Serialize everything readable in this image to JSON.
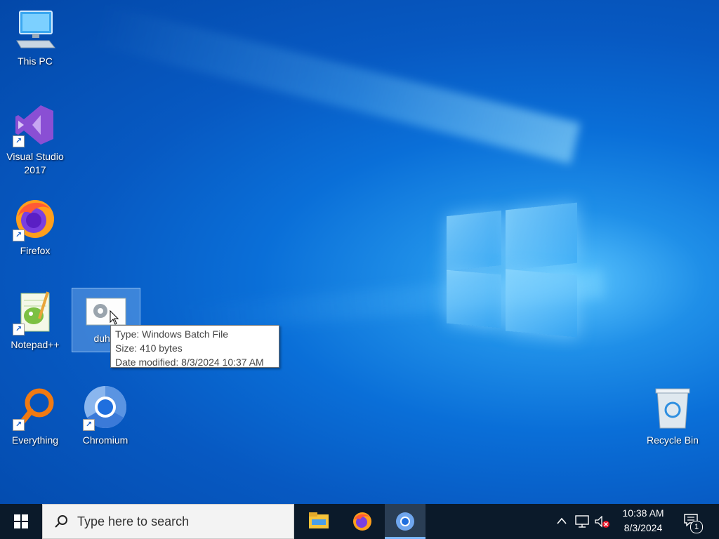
{
  "desktop": {
    "icons": {
      "this_pc": {
        "label": "This PC",
        "icon": "computer-icon"
      },
      "visual_studio": {
        "label": "Visual Studio\n2017",
        "icon": "visual-studio-icon"
      },
      "firefox": {
        "label": "Firefox",
        "icon": "firefox-icon"
      },
      "notepad": {
        "label": "Notepad++",
        "icon": "notepadpp-icon"
      },
      "duh": {
        "label": "duh.b",
        "icon": "batch-file-icon"
      },
      "everything": {
        "label": "Everything",
        "icon": "magnifier-icon"
      },
      "chromium": {
        "label": "Chromium",
        "icon": "chromium-icon"
      },
      "recycle_bin": {
        "label": "Recycle Bin",
        "icon": "recycle-bin-icon"
      }
    },
    "tooltip": {
      "type": "Type: Windows Batch File",
      "size": "Size: 410 bytes",
      "modified": "Date modified: 8/3/2024 10:37 AM"
    }
  },
  "taskbar": {
    "search_placeholder": "Type here to search",
    "apps": [
      "file-explorer-icon",
      "firefox-icon",
      "chromium-icon"
    ],
    "clock_time": "10:38 AM",
    "clock_date": "8/3/2024",
    "notification_count": "1",
    "colors": {
      "taskbar_bg": "#0b1a2a",
      "accent": "#7ab6ff"
    }
  }
}
